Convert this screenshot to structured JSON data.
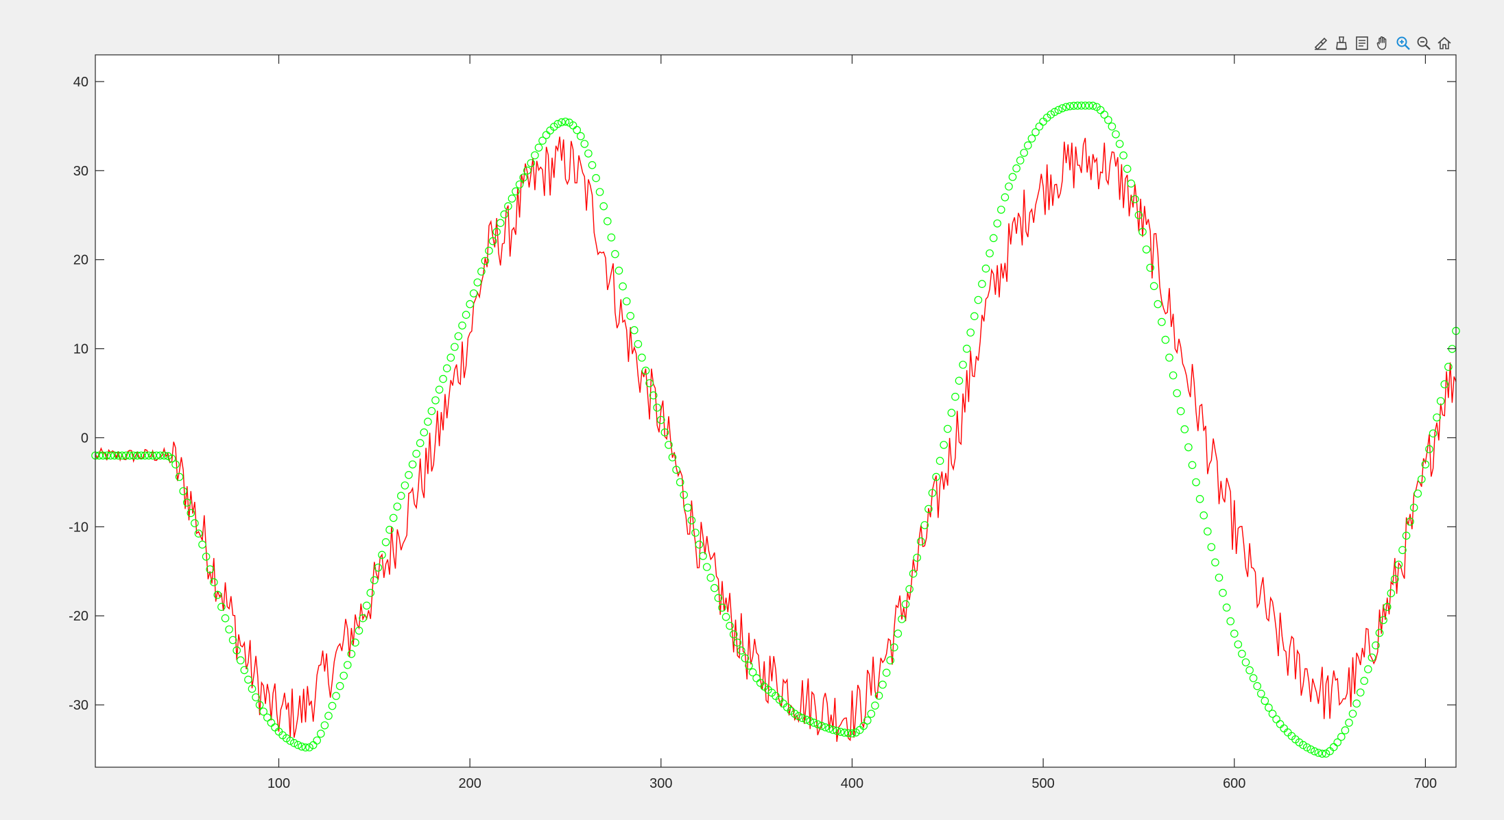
{
  "toolbar": {
    "items": [
      {
        "name": "brush-icon"
      },
      {
        "name": "data-tips-icon"
      },
      {
        "name": "legend-icon"
      },
      {
        "name": "pan-icon"
      },
      {
        "name": "zoom-in-icon"
      },
      {
        "name": "zoom-out-icon"
      },
      {
        "name": "home-icon"
      }
    ]
  },
  "chart_data": {
    "type": "line",
    "title": "",
    "xlabel": "",
    "ylabel": "",
    "xlim": [
      4,
      716
    ],
    "ylim": [
      -37,
      43
    ],
    "x_ticks": [
      100,
      200,
      300,
      400,
      500,
      600,
      700
    ],
    "y_ticks": [
      -30,
      -20,
      -10,
      0,
      10,
      20,
      30,
      40
    ],
    "grid": false,
    "legend": "none",
    "series": [
      {
        "style": "line",
        "color": "#ff0000",
        "x": [
          4,
          40,
          48,
          60,
          70,
          80,
          90,
          100,
          110,
          120,
          130,
          140,
          150,
          160,
          170,
          180,
          190,
          200,
          210,
          220,
          230,
          240,
          250,
          260,
          270,
          280,
          290,
          300,
          310,
          320,
          330,
          340,
          350,
          360,
          370,
          380,
          390,
          400,
          410,
          420,
          430,
          440,
          450,
          460,
          470,
          480,
          490,
          500,
          510,
          520,
          530,
          540,
          550,
          560,
          570,
          580,
          590,
          600,
          610,
          620,
          630,
          640,
          650,
          660,
          670,
          680,
          690,
          700,
          710,
          716
        ],
        "y": [
          -2,
          -2,
          -4,
          -11,
          -17,
          -23,
          -28,
          -31,
          -31,
          -28,
          -25,
          -21,
          -17,
          -12,
          -7,
          -2,
          5,
          12,
          21,
          23,
          28,
          30,
          31,
          28,
          21,
          13,
          7,
          2,
          -5,
          -12,
          -17,
          -22,
          -26,
          -27,
          -29,
          -30,
          -31,
          -31,
          -28,
          -23,
          -17,
          -10,
          -3,
          5,
          14,
          20,
          25,
          28,
          30,
          31,
          31,
          29,
          25,
          19,
          11,
          4,
          -4,
          -10,
          -16,
          -21,
          -25,
          -27,
          -29,
          -28,
          -24,
          -19,
          -12,
          -4,
          5,
          7
        ]
      },
      {
        "style": "marker",
        "marker": "circle",
        "color": "#00ff00",
        "x": [
          4,
          40,
          46,
          50,
          60,
          70,
          80,
          90,
          100,
          110,
          115,
          120,
          130,
          140,
          150,
          160,
          170,
          180,
          190,
          200,
          210,
          220,
          230,
          240,
          250,
          260,
          270,
          280,
          290,
          300,
          310,
          320,
          330,
          340,
          350,
          360,
          370,
          380,
          390,
          400,
          410,
          420,
          430,
          440,
          450,
          460,
          470,
          480,
          490,
          500,
          510,
          520,
          525,
          530,
          540,
          550,
          560,
          570,
          580,
          590,
          600,
          610,
          620,
          630,
          640,
          647,
          650,
          660,
          670,
          680,
          690,
          700,
          710,
          716
        ],
        "y": [
          -2,
          -2,
          -3,
          -6,
          -12,
          -19,
          -25,
          -30,
          -33,
          -34.5,
          -34.8,
          -34,
          -29,
          -23,
          -16,
          -9,
          -3,
          3,
          9,
          15,
          21,
          26,
          30,
          34,
          35.5,
          33,
          26,
          17,
          9,
          2,
          -5,
          -12,
          -18,
          -23,
          -27,
          -29,
          -31,
          -32,
          -32.8,
          -33.2,
          -31,
          -25,
          -17,
          -8,
          1,
          10,
          19,
          27,
          32,
          35.5,
          37,
          37.3,
          37.3,
          36.8,
          33,
          25,
          15,
          5,
          -5,
          -14,
          -22,
          -27,
          -31,
          -33.5,
          -35,
          -35.5,
          -35.2,
          -32,
          -26,
          -19,
          -11,
          -3,
          6,
          12
        ]
      }
    ]
  }
}
